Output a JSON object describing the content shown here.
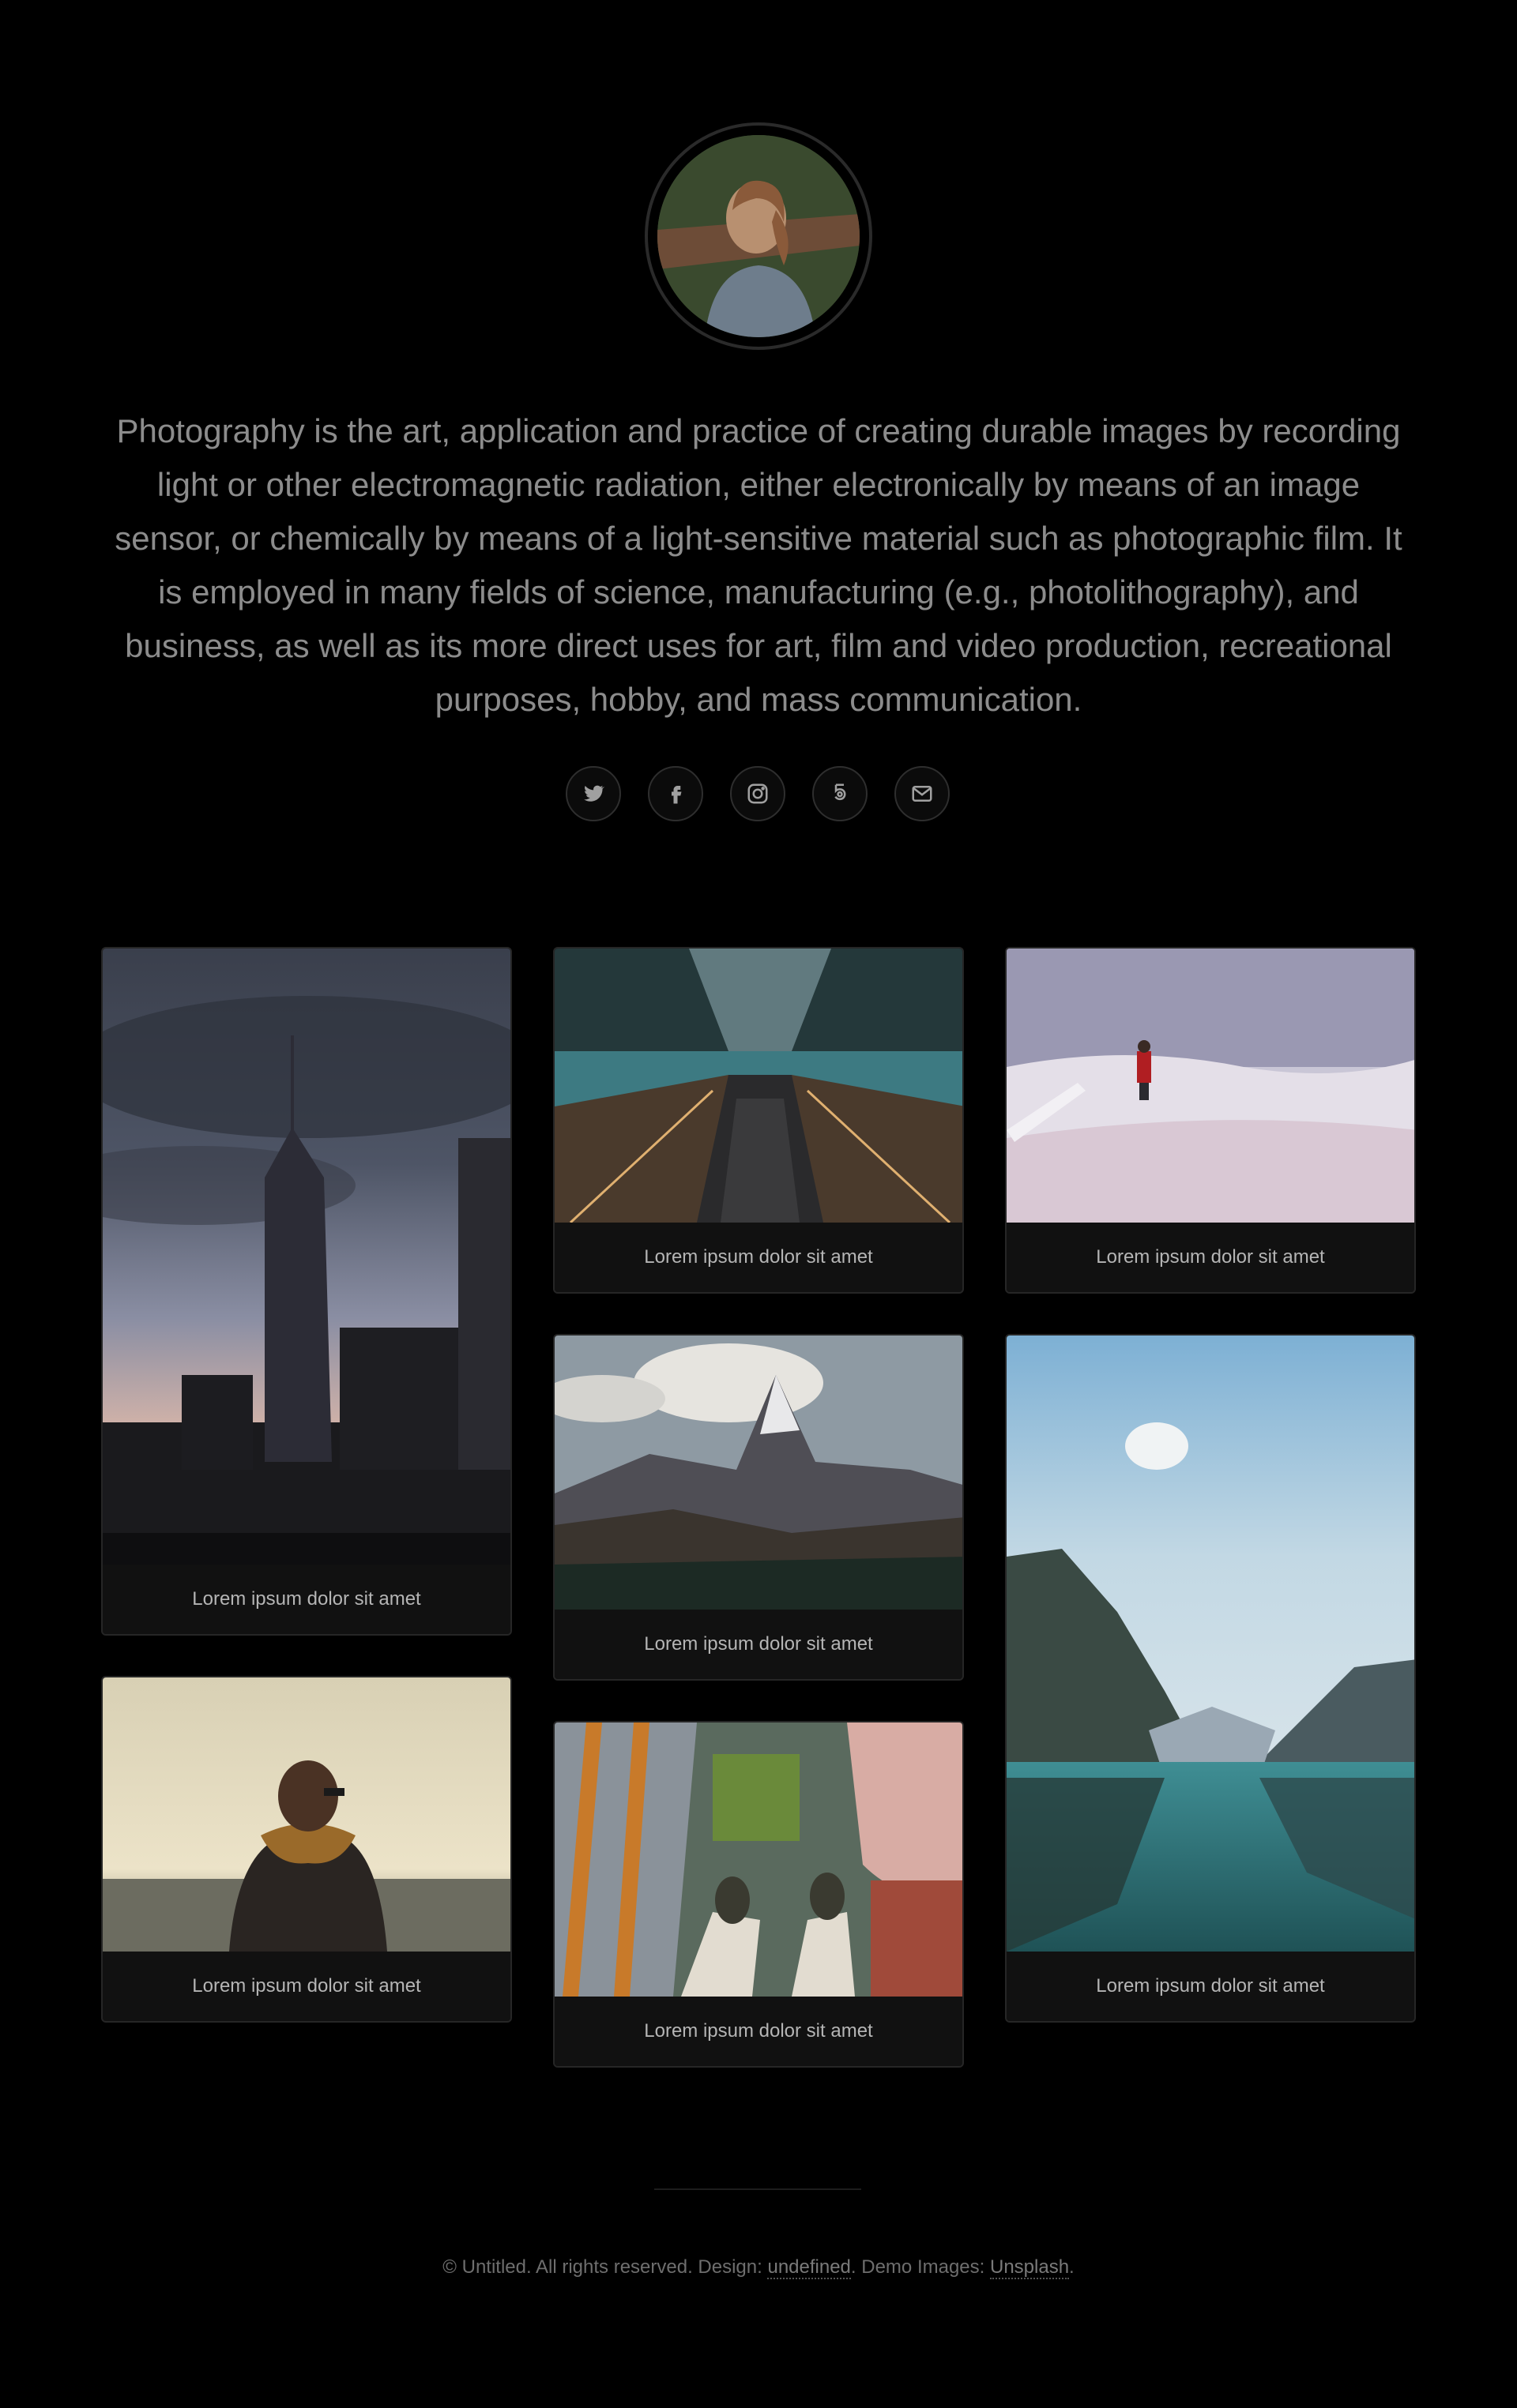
{
  "intro": {
    "text": "Photography is the art, application and practice of creating durable images by recording light or other electromagnetic radiation, either electronically by means of an image sensor, or chemically by means of a light-sensitive material such as photographic film. It is employed in many fields of science, manufacturing (e.g., photolithography), and business, as well as its more direct uses for art, film and video production, recreational purposes, hobby, and mass communication."
  },
  "social": [
    {
      "icon": "twitter-icon"
    },
    {
      "icon": "facebook-icon"
    },
    {
      "icon": "instagram-icon"
    },
    {
      "icon": "500px-icon"
    },
    {
      "icon": "envelope-icon"
    }
  ],
  "gallery": [
    {
      "caption": "Lorem ipsum dolor sit amet",
      "scene": "city skyline at dusk"
    },
    {
      "caption": "Lorem ipsum dolor sit amet",
      "scene": "escalator hallway"
    },
    {
      "caption": "Lorem ipsum dolor sit amet",
      "scene": "snowy field photographer"
    },
    {
      "caption": "Lorem ipsum dolor sit amet",
      "scene": "mountain peak"
    },
    {
      "caption": "Lorem ipsum dolor sit amet",
      "scene": "mountain lake reflection"
    },
    {
      "caption": "Lorem ipsum dolor sit amet",
      "scene": "person with scarf at sea"
    },
    {
      "caption": "Lorem ipsum dolor sit amet",
      "scene": "feet over city from above"
    }
  ],
  "footer": {
    "copyright": "© Untitled. All rights reserved.",
    "design_label": "Design:",
    "design_link": "undefined",
    "images_label": "Demo Images:",
    "images_link": "Unsplash"
  }
}
